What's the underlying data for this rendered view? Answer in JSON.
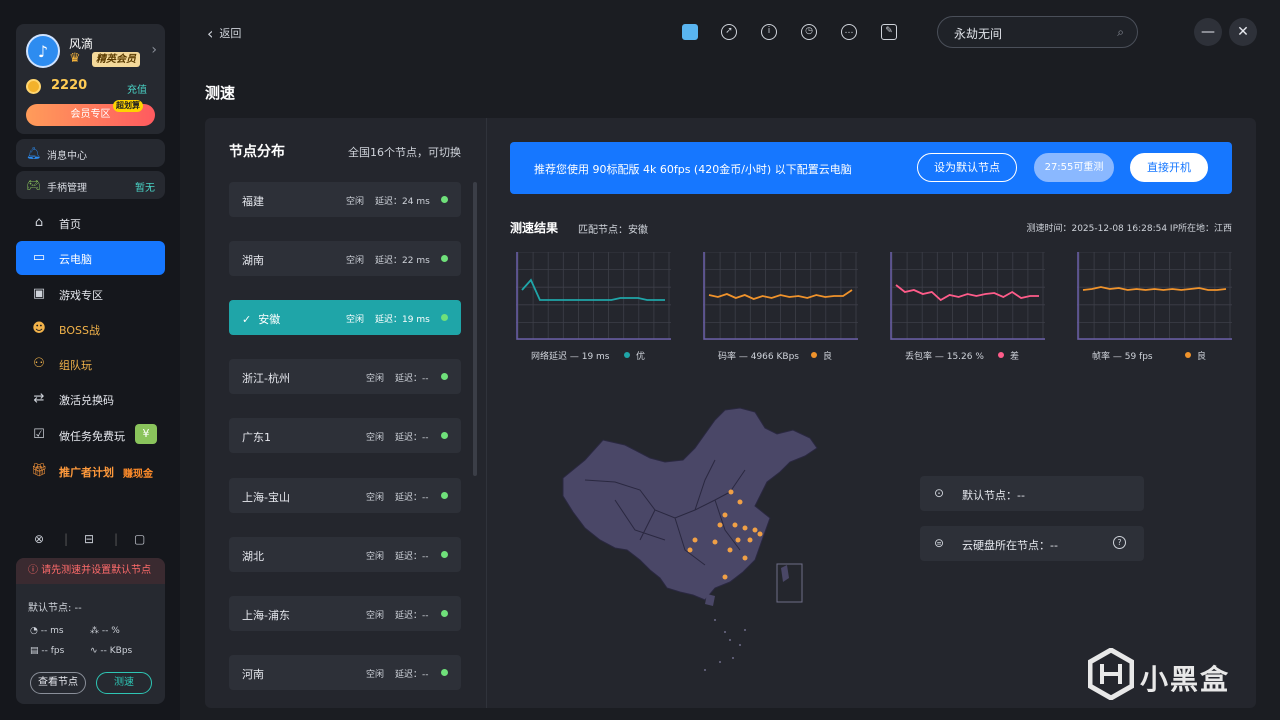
{
  "profile": {
    "name": "风滴",
    "vip_tag": "精英会员",
    "coins": "2220",
    "recharge": "充值",
    "vip_button": "会员专区",
    "vip_badge": "超划算"
  },
  "msg_center": "消息中心",
  "gamepad": {
    "label": "手柄管理",
    "status": "暂无"
  },
  "nav": [
    {
      "label": "首页",
      "icon": "home-icon"
    },
    {
      "label": "云电脑",
      "icon": "monitor-icon",
      "active": true
    },
    {
      "label": "游戏专区",
      "icon": "gamepad-icon"
    },
    {
      "label": "BOSS战",
      "icon": "boss-icon",
      "style": "gold"
    },
    {
      "label": "组队玩",
      "icon": "team-icon",
      "style": "gold"
    },
    {
      "label": "激活兑换码",
      "icon": "exchange-icon"
    },
    {
      "label": "做任务免费玩",
      "icon": "task-icon"
    },
    {
      "label": "推广者计划",
      "icon": "gift-icon",
      "style": "orange",
      "sub": "赚现金"
    }
  ],
  "speedcard": {
    "warn": "请先测速并设置默认节点",
    "default_node": "默认节点: --",
    "ms": "-- ms",
    "pct": "-- %",
    "fps": "-- fps",
    "kbps": "-- KBps",
    "view_nodes": "查看节点",
    "test": "测速"
  },
  "topbar": {
    "back": "返回",
    "search": "永劫无间"
  },
  "page_title": "测速",
  "nodes_panel": {
    "title": "节点分布",
    "subtitle": "全国16个节点，可切换"
  },
  "nodes": [
    {
      "name": "福建",
      "status": "空闲",
      "delay": "延迟：24 ms"
    },
    {
      "name": "湖南",
      "status": "空闲",
      "delay": "延迟：22 ms"
    },
    {
      "name": "安徽",
      "status": "空闲",
      "delay": "延迟：19 ms",
      "active": true
    },
    {
      "name": "浙江-杭州",
      "status": "空闲",
      "delay": "延迟：--"
    },
    {
      "name": "广东1",
      "status": "空闲",
      "delay": "延迟：--"
    },
    {
      "name": "上海-宝山",
      "status": "空闲",
      "delay": "延迟：--"
    },
    {
      "name": "湖北",
      "status": "空闲",
      "delay": "延迟：--"
    },
    {
      "name": "上海-浦东",
      "status": "空闲",
      "delay": "延迟：--"
    },
    {
      "name": "河南",
      "status": "空闲",
      "delay": "延迟：--"
    }
  ],
  "banner": {
    "text": "推荐您使用 90标配版 4k 60fps (420金币/小时) 以下配置云电脑",
    "set_default": "设为默认节点",
    "retest": "27:55可重测",
    "start": "直接开机"
  },
  "result": {
    "title": "测速结果",
    "match": "匹配节点：安徽",
    "time": "测速时间：2025-12-08 16:28:54 IP所在地：江西"
  },
  "metrics": [
    {
      "label": "网络延迟 — 19 ms",
      "quality": "优",
      "color": "#1fa5a8",
      "values": [
        50,
        60,
        40,
        40,
        40,
        40,
        40,
        40,
        40,
        40,
        40,
        42,
        42,
        42,
        40,
        40,
        40
      ]
    },
    {
      "label": "码率 — 4966 KBps",
      "quality": "良",
      "color": "#f0932b",
      "values": [
        45,
        43,
        46,
        42,
        45,
        41,
        44,
        42,
        45,
        43,
        44,
        42,
        45,
        43,
        44,
        44,
        50
      ]
    },
    {
      "label": "丢包率 — 15.26 %",
      "quality": "差",
      "color": "#ff5c8a",
      "values": [
        55,
        48,
        50,
        46,
        48,
        40,
        45,
        43,
        46,
        44,
        46,
        47,
        43,
        48,
        42,
        44,
        44
      ]
    },
    {
      "label": "帧率 — 59 fps",
      "quality": "良",
      "color": "#f0932b",
      "values": [
        50,
        51,
        53,
        51,
        52,
        50,
        51,
        50,
        51,
        50,
        51,
        50,
        51,
        52,
        50,
        50,
        51
      ]
    }
  ],
  "info": {
    "default_node": "默认节点：--",
    "disk_node": "云硬盘所在节点：--"
  },
  "watermark": "小黑盒"
}
